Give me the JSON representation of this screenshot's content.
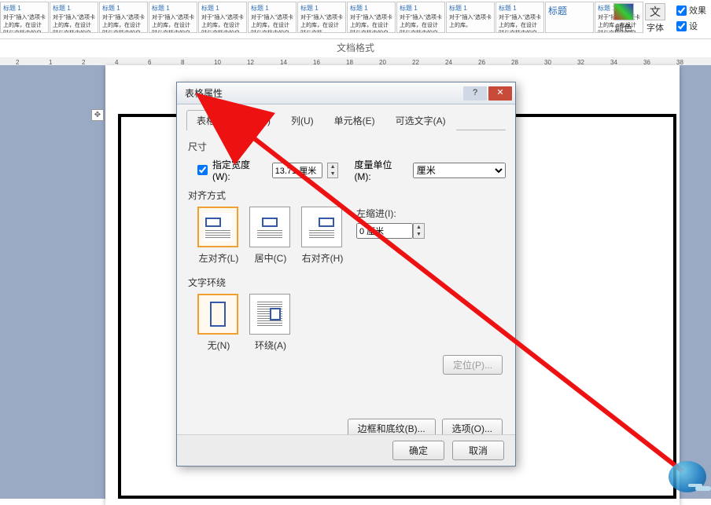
{
  "ribbon": {
    "style_items": [
      "标题 1",
      "标题 1",
      "标题 1",
      "标题 1",
      "标题 1",
      "标题 1",
      "标题 1",
      "标题 1",
      "标题 1",
      "标题 1",
      "标题 1",
      "标题",
      "标题 1"
    ],
    "color_label": "颜色",
    "font_label": "字体",
    "effects_label": "效果",
    "setup_label": "设",
    "doc_style_label": "文档格式"
  },
  "ruler": {
    "ticks": [
      "2",
      "1",
      "2",
      "4",
      "6",
      "8",
      "10",
      "12",
      "14",
      "16",
      "18",
      "20",
      "22",
      "24",
      "26",
      "28",
      "30",
      "32",
      "34",
      "36",
      "38"
    ]
  },
  "dialog": {
    "title": "表格属性",
    "tabs": {
      "table": "表格(T)",
      "row": "行(R)",
      "column": "列(U)",
      "cell": "单元格(E)",
      "alt": "可选文字(A)"
    },
    "size_label": "尺寸",
    "width_chk": "指定宽度(W):",
    "width_value": "13.71 厘米",
    "unit_label": "度量单位(M):",
    "unit_value": "厘米",
    "align_label": "对齐方式",
    "align_left": "左对齐(L)",
    "align_center": "居中(C)",
    "align_right": "右对齐(H)",
    "indent_label": "左缩进(I):",
    "indent_value": "0 厘米",
    "wrap_label": "文字环绕",
    "wrap_none": "无(N)",
    "wrap_around": "环绕(A)",
    "position_btn": "定位(P)...",
    "borders_btn": "边框和底纹(B)...",
    "options_btn": "选项(O)...",
    "ok": "确定",
    "cancel": "取消"
  }
}
